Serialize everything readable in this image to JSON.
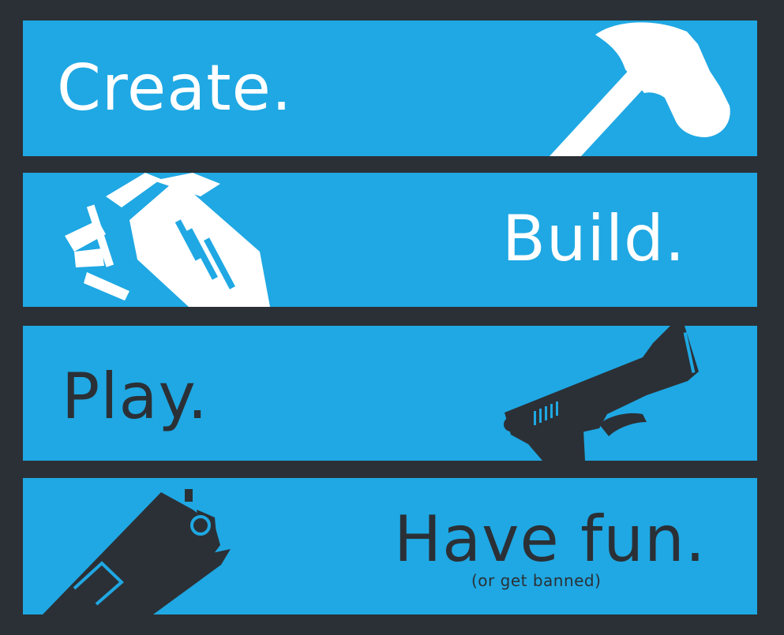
{
  "poster": {
    "panels": [
      {
        "text": "Create.",
        "icon": "hammer-icon"
      },
      {
        "text": "Build.",
        "icon": "toolgun-icon"
      },
      {
        "text": "Play.",
        "icon": "pistol-icon"
      },
      {
        "text": "Have fun.",
        "subtext": "(or get banned)",
        "icon": "physgun-icon"
      }
    ]
  },
  "colors": {
    "background": "#2b3036",
    "panel": "#1fa8e3",
    "light_text": "#ffffff",
    "dark_text": "#2b3036"
  }
}
